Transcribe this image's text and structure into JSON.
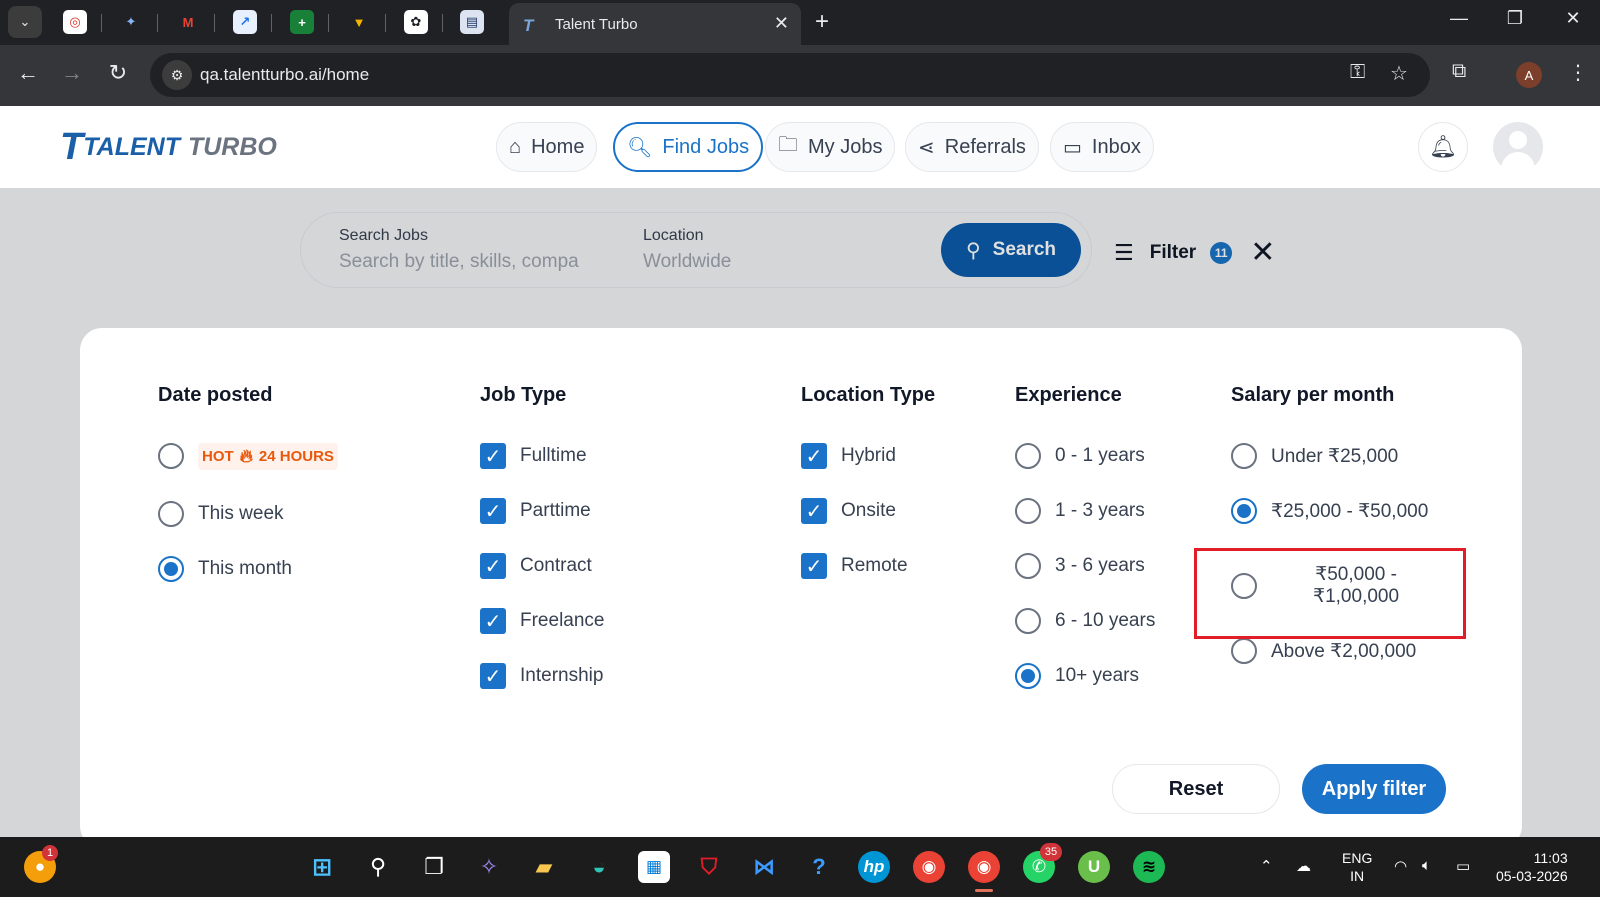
{
  "browser": {
    "active_tab_title": "Talent Turbo",
    "url": "qa.talentturbo.ai/home",
    "profile_initial": "A"
  },
  "brand": {
    "word1": "TALENT",
    "word2": "TURBO"
  },
  "nav": [
    {
      "label": "Home",
      "icon": "home-icon"
    },
    {
      "label": "Find Jobs",
      "icon": "search-icon"
    },
    {
      "label": "My Jobs",
      "icon": "briefcase-icon"
    },
    {
      "label": "Referrals",
      "icon": "share-icon"
    },
    {
      "label": "Inbox",
      "icon": "chat-icon"
    }
  ],
  "search": {
    "jobs_label": "Search Jobs",
    "jobs_placeholder": "Search by title, skills, compa",
    "location_label": "Location",
    "location_placeholder": "Worldwide",
    "button_label": "Search"
  },
  "filter": {
    "label": "Filter",
    "count": "11"
  },
  "date_posted": {
    "title": "Date posted",
    "hot_label": "HOT",
    "hot_hours": "24 HOURS",
    "options": [
      {
        "label": "This week",
        "selected": false
      },
      {
        "label": "This month",
        "selected": true
      }
    ]
  },
  "job_type": {
    "title": "Job Type",
    "options": [
      {
        "label": "Fulltime",
        "checked": true
      },
      {
        "label": "Parttime",
        "checked": true
      },
      {
        "label": "Contract",
        "checked": true
      },
      {
        "label": "Freelance",
        "checked": true
      },
      {
        "label": "Internship",
        "checked": true
      }
    ]
  },
  "location_type": {
    "title": "Location Type",
    "options": [
      {
        "label": "Hybrid",
        "checked": true
      },
      {
        "label": "Onsite",
        "checked": true
      },
      {
        "label": "Remote",
        "checked": true
      }
    ]
  },
  "experience": {
    "title": "Experience",
    "options": [
      {
        "label": "0 - 1 years",
        "selected": false
      },
      {
        "label": "1 - 3 years",
        "selected": false
      },
      {
        "label": "3 - 6 years",
        "selected": false
      },
      {
        "label": "6 - 10 years",
        "selected": false
      },
      {
        "label": "10+ years",
        "selected": true
      }
    ]
  },
  "salary": {
    "title": "Salary per month",
    "options": [
      {
        "label": "Under ₹25,000",
        "selected": false
      },
      {
        "label": "₹25,000 - ₹50,000",
        "selected": true
      },
      {
        "line1": "₹50,000 -",
        "line2": "₹1,00,000",
        "selected": false
      },
      {
        "label": "Above ₹2,00,000",
        "selected": false
      }
    ]
  },
  "actions": {
    "reset": "Reset",
    "apply": "Apply filter"
  },
  "taskbar": {
    "notif_count": "1",
    "whatsapp_count": "35",
    "lang1": "ENG",
    "lang2": "IN",
    "time": "11:03",
    "date": "05-03-2026"
  },
  "colors": {
    "accent": "#1a73c8",
    "search_button": "#0b5cab",
    "highlight": "#e11d2a",
    "hot": "#e8590c"
  }
}
